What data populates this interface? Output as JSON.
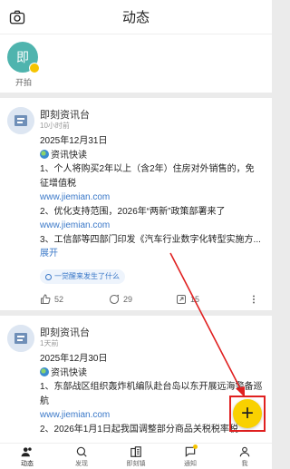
{
  "header": {
    "title": "动态"
  },
  "stories": [
    {
      "avatar_text": "即",
      "label": "开拍"
    }
  ],
  "posts": [
    {
      "author": "即刻资讯台",
      "time": "10小时前",
      "lines": [
        "2025年12月31日",
        "资讯快读",
        "1、个人将购买2年以上（含2年）住房对外销售的，免征增值税",
        "www.jiemian.com",
        "2、优化支持范围，2026年“两新”政策部署来了",
        "www.jiemian.com",
        "3、工信部等四部门印发《汽车行业数字化转型实施方..."
      ],
      "expand": "展开",
      "topic": "一觉醒来发生了什么",
      "likes": "52",
      "comments": "29",
      "shares": "15"
    },
    {
      "author": "即刻资讯台",
      "time": "1天前",
      "lines": [
        "2025年12月30日",
        "资讯快读",
        "1、东部战区组织轰炸机编队赴台岛以东开展远海警备巡航",
        "www.jiemian.com",
        "2、2026年1月1日起我国调整部分商品关税税率税"
      ]
    }
  ],
  "tabs": [
    "动态",
    "发现",
    "即刻镇",
    "通知",
    "我"
  ],
  "colors": {
    "accent": "#f9d100",
    "link": "#3a78c8",
    "highlight": "#e02020"
  }
}
